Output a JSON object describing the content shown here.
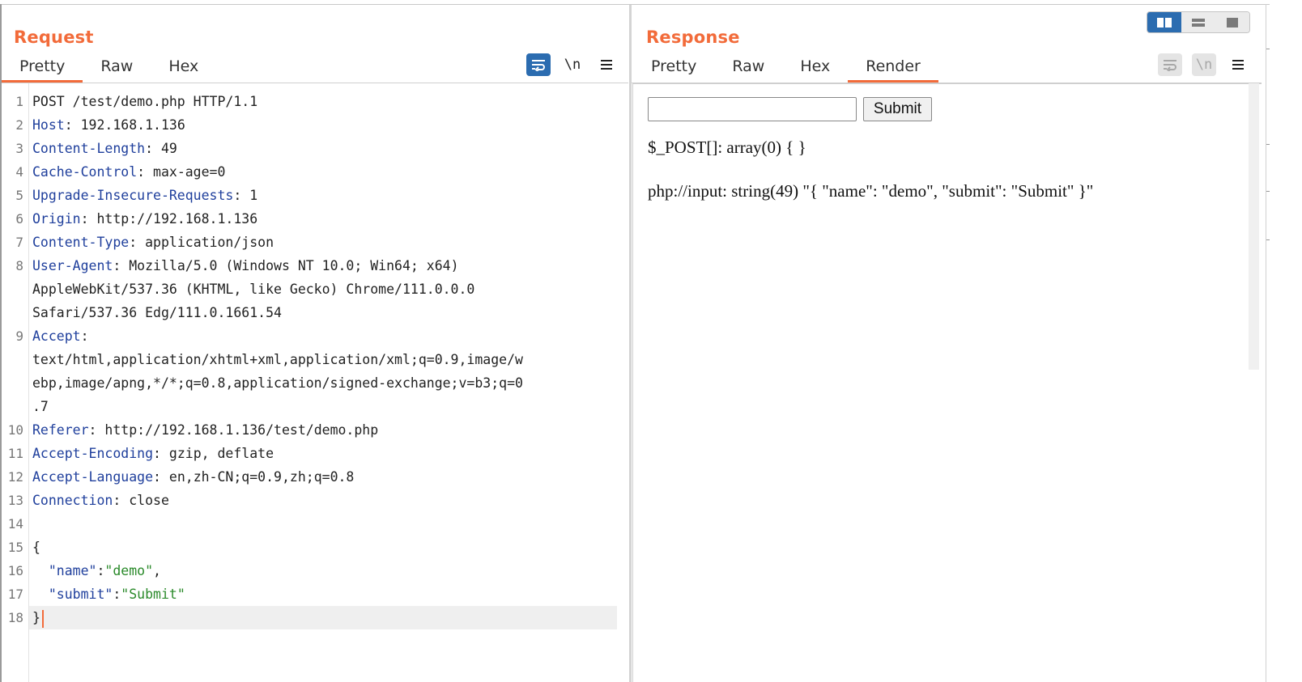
{
  "view_switch": {
    "options": [
      "side-by-side-icon",
      "stacked-icon",
      "single-icon"
    ],
    "active": "side-by-side-icon"
  },
  "request": {
    "title": "Request",
    "tabs": [
      "Pretty",
      "Raw",
      "Hex"
    ],
    "active_tab": "Pretty",
    "tools": {
      "wrap_icon": "word-wrap-icon",
      "newline_label": "\\n",
      "menu_icon": "hamburger-menu-icon"
    },
    "lines": [
      {
        "n": "1",
        "key": "",
        "value": "POST /test/demo.php HTTP/1.1"
      },
      {
        "n": "2",
        "key": "Host",
        "value": "192.168.1.136"
      },
      {
        "n": "3",
        "key": "Content-Length",
        "value": "49"
      },
      {
        "n": "4",
        "key": "Cache-Control",
        "value": "max-age=0"
      },
      {
        "n": "5",
        "key": "Upgrade-Insecure-Requests",
        "value": "1"
      },
      {
        "n": "6",
        "key": "Origin",
        "value": "http://192.168.1.136"
      },
      {
        "n": "7",
        "key": "Content-Type",
        "value": "application/json"
      },
      {
        "n": "8",
        "key": "User-Agent",
        "value": "Mozilla/5.0 (Windows NT 10.0; Win64; x64)"
      },
      {
        "n": "",
        "key": "",
        "value": "AppleWebKit/537.36 (KHTML, like Gecko) Chrome/111.0.0.0"
      },
      {
        "n": "",
        "key": "",
        "value": "Safari/537.36 Edg/111.0.1661.54"
      },
      {
        "n": "9",
        "key": "Accept",
        "value": ""
      },
      {
        "n": "",
        "key": "",
        "value": "text/html,application/xhtml+xml,application/xml;q=0.9,image/w"
      },
      {
        "n": "",
        "key": "",
        "value": "ebp,image/apng,*/*;q=0.8,application/signed-exchange;v=b3;q=0"
      },
      {
        "n": "",
        "key": "",
        "value": ".7"
      },
      {
        "n": "10",
        "key": "Referer",
        "value": "http://192.168.1.136/test/demo.php"
      },
      {
        "n": "11",
        "key": "Accept-Encoding",
        "value": "gzip, deflate"
      },
      {
        "n": "12",
        "key": "Accept-Language",
        "value": "en,zh-CN;q=0.9,zh;q=0.8"
      },
      {
        "n": "13",
        "key": "Connection",
        "value": "close"
      },
      {
        "n": "14",
        "key": "",
        "value": ""
      },
      {
        "n": "15",
        "key": "",
        "value": "{"
      }
    ],
    "json_lines": [
      {
        "n": "16",
        "indent": "  ",
        "jkey": "\"name\"",
        "sep": ":",
        "jval": "\"demo\"",
        "tail": ","
      },
      {
        "n": "17",
        "indent": "  ",
        "jkey": "\"submit\"",
        "sep": ":",
        "jval": "\"Submit\"",
        "tail": ""
      }
    ],
    "last_line": {
      "n": "18",
      "value": "}"
    }
  },
  "response": {
    "title": "Response",
    "tabs": [
      "Pretty",
      "Raw",
      "Hex",
      "Render"
    ],
    "active_tab": "Render",
    "tools": {
      "wrap_icon": "word-wrap-icon",
      "newline_label": "\\n",
      "menu_icon": "hamburger-menu-icon"
    },
    "render": {
      "input_value": "",
      "submit_label": "Submit",
      "post_dump": "$_POST[]: array(0) { }",
      "input_dump": "php://input: string(49) \"{ \"name\": \"demo\", \"submit\": \"Submit\" }\""
    }
  },
  "colors": {
    "accent": "#f26b3a",
    "active_button": "#2b6cb0",
    "header_key": "#1f3f9c",
    "json_string": "#2a8a2a"
  }
}
